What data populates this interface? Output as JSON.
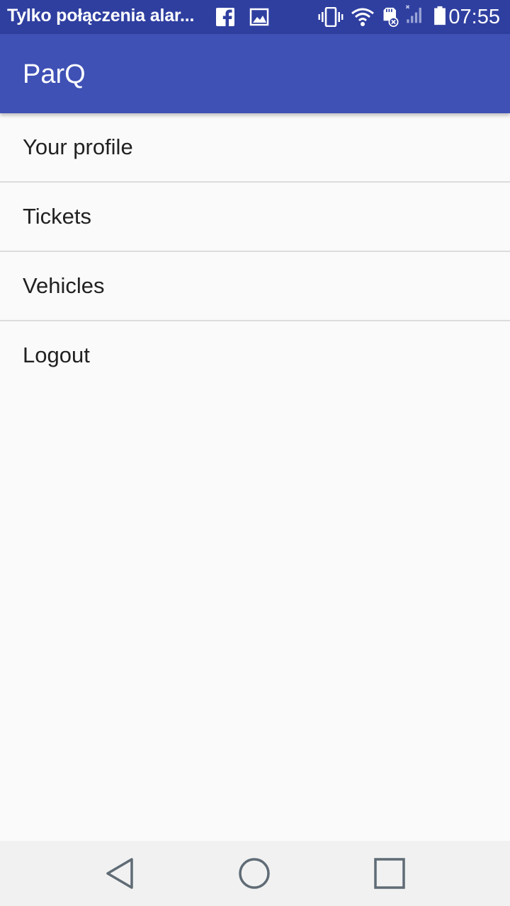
{
  "status_bar": {
    "notification_text": "Tylko połączenia alar...",
    "time": "07:55",
    "icons": [
      "facebook-icon",
      "image-icon",
      "vibrate-icon",
      "wifi-icon",
      "sd-card-icon",
      "signal-icon",
      "battery-icon"
    ]
  },
  "app_bar": {
    "title": "ParQ"
  },
  "menu": {
    "items": [
      {
        "label": "Your profile"
      },
      {
        "label": "Tickets"
      },
      {
        "label": "Vehicles"
      },
      {
        "label": "Logout"
      }
    ]
  },
  "nav_bar": {
    "icons": [
      "back-icon",
      "home-icon",
      "recents-icon"
    ]
  },
  "colors": {
    "status_bar": "#2f3fa0",
    "primary": "#3f51b5",
    "background": "#fafafa",
    "nav_bar": "#f1f1f1",
    "nav_icon": "#5f6b75"
  }
}
